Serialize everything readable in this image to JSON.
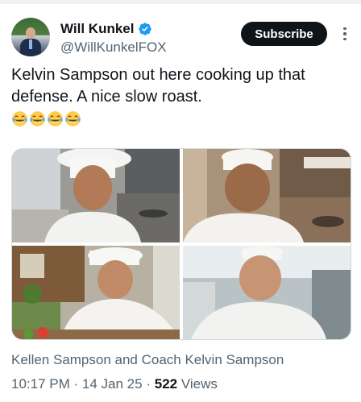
{
  "author": {
    "name": "Will Kunkel",
    "handle": "@WillKunkelFOX",
    "avatar_icon": "profile-photo",
    "verified_color": "#1d9bf0"
  },
  "header": {
    "subscribe_label": "Subscribe",
    "more_icon": "vertical-ellipsis-icon"
  },
  "tweet": {
    "text": "Kelvin Sampson out here cooking up that defense. A nice slow roast.",
    "emojis": [
      "tears-of-joy",
      "tears-of-joy",
      "tears-of-joy",
      "tears-of-joy"
    ]
  },
  "media": {
    "photos": [
      {
        "subject": "chef in white toque in kitchen"
      },
      {
        "subject": "smiling chef in white toque"
      },
      {
        "subject": "chef cutting vegetables"
      },
      {
        "subject": "chef in white jacket in kitchen"
      }
    ]
  },
  "caption": "Kellen Sampson and Coach Kelvin Sampson",
  "meta": {
    "time": "10:17 PM",
    "separator": "·",
    "date": "14 Jan 25",
    "views_count": "522",
    "views_label": "Views"
  },
  "colors": {
    "text": "#0f1419",
    "secondary": "#536471",
    "verified": "#1d9bf0",
    "button": "#0f1419"
  }
}
